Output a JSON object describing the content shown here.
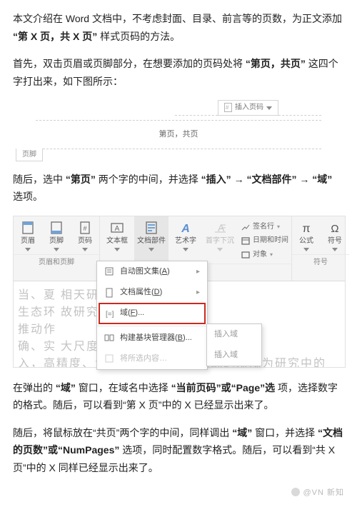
{
  "text": {
    "p1a": "本文介绍在 Word 文档中，不考虑封面、目录、前言等的页数，为正文添加",
    "p1b": "“第 X 页，共 X 页”",
    "p1c": "样式页码的方法。",
    "p2a": "首先，双击页眉或页脚部分，在想要添加的页码处将",
    "p2b": "“第页，共页”",
    "p2c": "这四个字打出来，如下图所示：",
    "p3a": "随后，选中",
    "p3b": "“第页”",
    "p3c": "两个字的中间，并选择",
    "p3d": "“插入”",
    "arrow": " → ",
    "p3e": "“文档部件”",
    "p3f": "“域”",
    "p3g": "选项。",
    "p4a": "在弹出的",
    "p4b": "“域”",
    "p4c": "窗口，在域名中选择",
    "p4d": "“当前页码”或“Page”选",
    "p4e": "项，选择数字的格式。随后，可以看到“第 X 页”中的 X 已经显示出来了。",
    "p5a": "随后，将鼠标放在“共页”两个字的中间，同样调出",
    "p5b": "“域”",
    "p5c": "窗口，并选择",
    "p5d": "“文档的页数”或“NumPages”",
    "p5e": "选项，同时配置数字格式。随后，可以看到“共 X 页”中的 X 同样已经显示出来了。"
  },
  "fig1": {
    "insert_pagenum": "插入页码",
    "footer_tab": "页脚",
    "center_text": "第页，共页"
  },
  "ribbon": {
    "groups": {
      "hf": {
        "name": "页眉和页脚",
        "btns": [
          "页眉",
          "页脚",
          "页码"
        ]
      },
      "insert": {
        "btns": [
          "文本框",
          "文档部件",
          "艺术字",
          "首字下沉"
        ]
      },
      "mini": [
        "签名行",
        "日期和时间",
        "对象"
      ],
      "eq": {
        "name": "符号",
        "btns": [
          "公式",
          "符号"
        ]
      }
    },
    "dropdown": {
      "items": [
        {
          "label": "自动图文集",
          "hot": "A",
          "arrow": true
        },
        {
          "label": "文档属性",
          "hot": "D",
          "arrow": true
        },
        {
          "label": "域",
          "hot": "F",
          "ell": true,
          "selected": true
        },
        {
          "label": "构建基块管理器",
          "hot": "B",
          "ell": true
        },
        {
          "label": "将所选内容…",
          "disabled": true
        }
      ],
      "sub": [
        "插入域",
        "插入域"
      ]
    }
  },
  "ghost": {
    "l1": "当、夏                                              相天研究具有至",
    "l2": "生态环                                              故研究由定性到",
    "l3": "推动作                                              ",
    "l4": "确、实                                              大尺度空间范围",
    "l5": "入，高精度、大覆盖区域的数据来源逐渐成为研究中的"
  },
  "credit": "@VN 新知"
}
